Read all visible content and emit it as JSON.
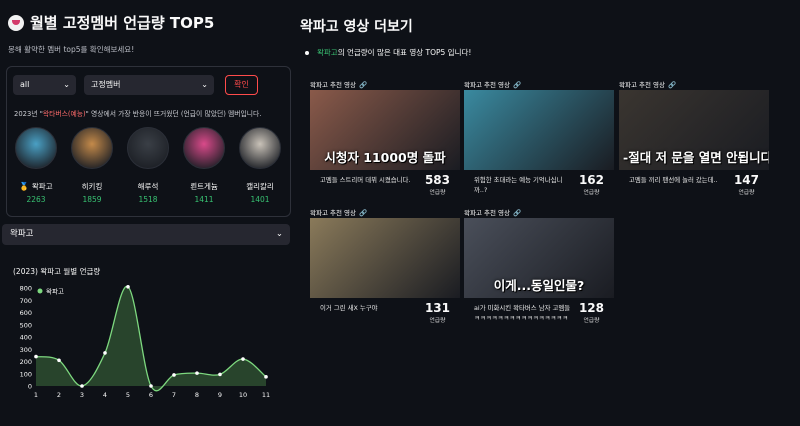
{
  "left": {
    "title": "월별 고정멤버 언급량 TOP5",
    "subtitle": "몽해 활약한 멤버 top5를 확인해보세요!",
    "filters": {
      "year_value": "all",
      "group_value": "고정멤버",
      "confirm_label": "확인"
    },
    "note": {
      "prefix": "2023년 \"",
      "highlight": "왁타버스(예능)",
      "suffix": "\" 영상에서 가장 반응이 뜨거웠던 (언급이 많았던) 멤버입니다."
    },
    "members": [
      {
        "name": "왁파고",
        "count": "2263",
        "medal": "🥇",
        "color": "#4aa0c4"
      },
      {
        "name": "히키킹",
        "count": "1859",
        "color": "#c48a4a"
      },
      {
        "name": "해루석",
        "count": "1518",
        "color": "#3a3f46"
      },
      {
        "name": "뢴트게늄",
        "count": "1411",
        "color": "#d94a8a"
      },
      {
        "name": "캘리칼리",
        "count": "1401",
        "color": "#c9c2b8"
      }
    ],
    "member_select_value": "왁파고"
  },
  "chart_data": {
    "type": "area",
    "title": "(2023) 왁파고 월별 언급량",
    "series": [
      {
        "name": "왁파고",
        "values": [
          240,
          210,
          0,
          270,
          810,
          0,
          90,
          105,
          95,
          220,
          75
        ]
      }
    ],
    "x": [
      1,
      2,
      3,
      4,
      5,
      6,
      7,
      8,
      9,
      10,
      11
    ],
    "ylim": [
      0,
      800
    ],
    "yticks": [
      0,
      100,
      200,
      300,
      400,
      500,
      600,
      700,
      800
    ],
    "legend": "top-left",
    "colors": {
      "line": "#7dd87f",
      "fill": "#2b4a2f",
      "point": "#ffffff"
    }
  },
  "right": {
    "title": "왁파고 영상 더보기",
    "bullet": {
      "highlight": "왁파고",
      "rest": "의 언급량이 많은 대표 영상 TOP5 입니다!"
    },
    "card_label": "왁파고 추천 영상",
    "link_icon": "🔗",
    "unit": "언급량",
    "videos": [
      {
        "caption": "시청자 11000명 돌파",
        "desc": "고멤들 스트리머 데뷔 시켰습니다.",
        "count": "583",
        "bg": "#8a5a4a"
      },
      {
        "caption": "",
        "desc": "위험한 초대라는 예능 기억나십니까..?",
        "count": "162",
        "bg": "#3a8aa0"
      },
      {
        "caption": "-절대 저 문을 열면 안됩니다",
        "desc": "고멤들 끼리 팬선에 놀러 갔는데..",
        "count": "147",
        "bg": "#3a3530"
      },
      {
        "caption": "",
        "desc": "이거 그린 새X 누구야",
        "count": "131",
        "bg": "#8a7a5a"
      },
      {
        "caption": "이게...동일인물?",
        "desc": "ai가 미화시킨 왁타버스 남자 고멤들 ㅋㅋㅋㅋㅋㅋㅋㅋㅋㅋㅋㅋㅋㅋㅋㅋ",
        "count": "128",
        "bg": "#4a4f5a"
      }
    ]
  }
}
